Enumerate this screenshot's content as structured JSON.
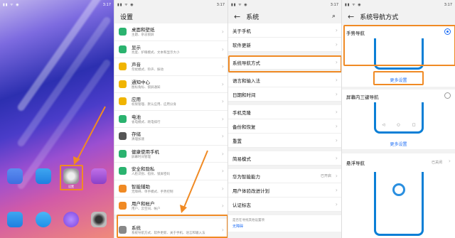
{
  "status_time": "3:17",
  "home": {
    "app_label_settings": "设置"
  },
  "settings": {
    "title": "设置",
    "items": [
      {
        "title": "桌面和壁纸",
        "subtitle": "主题、杂志锁屏",
        "color": "#2bb36f"
      },
      {
        "title": "显示",
        "subtitle": "亮度、护眼模式、文本和显示大小",
        "color": "#2bb36f"
      },
      {
        "title": "声音",
        "subtitle": "勿扰模式、铃声、振动",
        "color": "#f0b400"
      },
      {
        "title": "通知中心",
        "subtitle": "图标角标、锁屏通知",
        "color": "#f0b400"
      },
      {
        "title": "应用",
        "subtitle": "权限管理、默认应用、应用分身",
        "color": "#f0b400"
      },
      {
        "title": "电池",
        "subtitle": "省电模式、耗电排行",
        "color": "#2bb36f"
      },
      {
        "title": "存储",
        "subtitle": "清理加速",
        "color": "#555555"
      },
      {
        "title": "健康使用手机",
        "subtitle": "屏幕时间管理",
        "color": "#2bb36f"
      },
      {
        "title": "安全和隐私",
        "subtitle": "人脸识别、指纹、锁屏密码",
        "color": "#2bb36f"
      },
      {
        "title": "智能辅助",
        "subtitle": "无障碍、单手模式、手势控制",
        "color": "#f08a24"
      },
      {
        "title": "用户和帐户",
        "subtitle": "用户、云空间、帐户",
        "color": "#f08a24"
      },
      {
        "title": "系统",
        "subtitle": "系统导航方式、软件更新、关于手机、语言和输入法",
        "color": "#888888"
      }
    ]
  },
  "system": {
    "title": "系统",
    "groups": [
      [
        "关于手机",
        "软件更新"
      ],
      [
        "系统导航方式"
      ],
      [
        "语言和输入法",
        "日期和时间"
      ],
      [
        "手机克隆",
        "备份和恢复",
        "重置"
      ],
      [
        "简易模式"
      ],
      [
        "华为智能能力",
        "用户体验改进计划",
        "认证标志"
      ]
    ],
    "huawei_value": "已开启",
    "bottom_hint": "是否在寻找其他设置项",
    "bottom_link": "无障碍"
  },
  "nav": {
    "title": "系统导航方式",
    "gesture_label": "手势导航",
    "more_settings": "更多设置",
    "three_key_label": "屏幕内三键导航",
    "more_settings_2": "更多设置",
    "float_label": "悬浮导航",
    "float_value": "已关闭"
  },
  "colors": {
    "highlight": "#f08a24",
    "accent": "#1e6ef5"
  }
}
